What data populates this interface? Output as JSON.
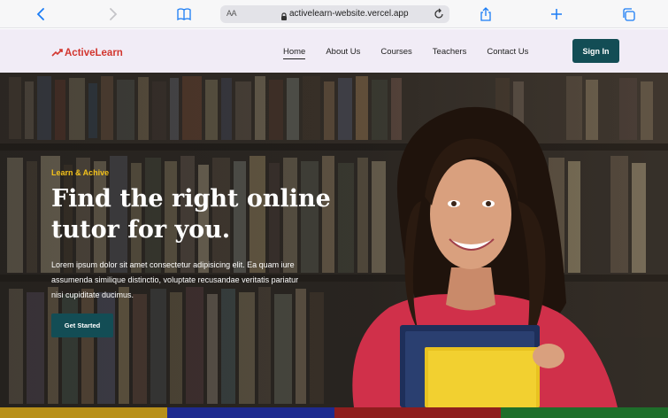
{
  "browser": {
    "aa_label": "AA",
    "url": "activelearn-website.vercel.app"
  },
  "site": {
    "logo_text": "ActiveLearn",
    "nav": [
      {
        "label": "Home",
        "active": true
      },
      {
        "label": "About Us"
      },
      {
        "label": "Courses"
      },
      {
        "label": "Teachers"
      },
      {
        "label": "Contact Us"
      }
    ],
    "signin_label": "Sign In"
  },
  "hero": {
    "eyebrow": "Learn & Achive",
    "headline_line1": "Find the right online",
    "headline_line2": "tutor for you.",
    "lead_line1": "Lorem ipsum dolor sit amet consectetur adipisicing elit. Ea quam iure",
    "lead_line2": "assumenda similique distinctio, voluptate recusandae veritatis pariatur",
    "lead_line3": "nisi cupiditate ducimus.",
    "cta_label": "Get Started"
  },
  "colors": {
    "brand_primary": "#134d55",
    "accent_yellow": "#f3c21b",
    "logo_red": "#d2362f",
    "ios_blue": "#1a7cf5",
    "strip": [
      "#b8901a",
      "#1e2a8e",
      "#8e1e1e",
      "#1e6e2a"
    ]
  }
}
